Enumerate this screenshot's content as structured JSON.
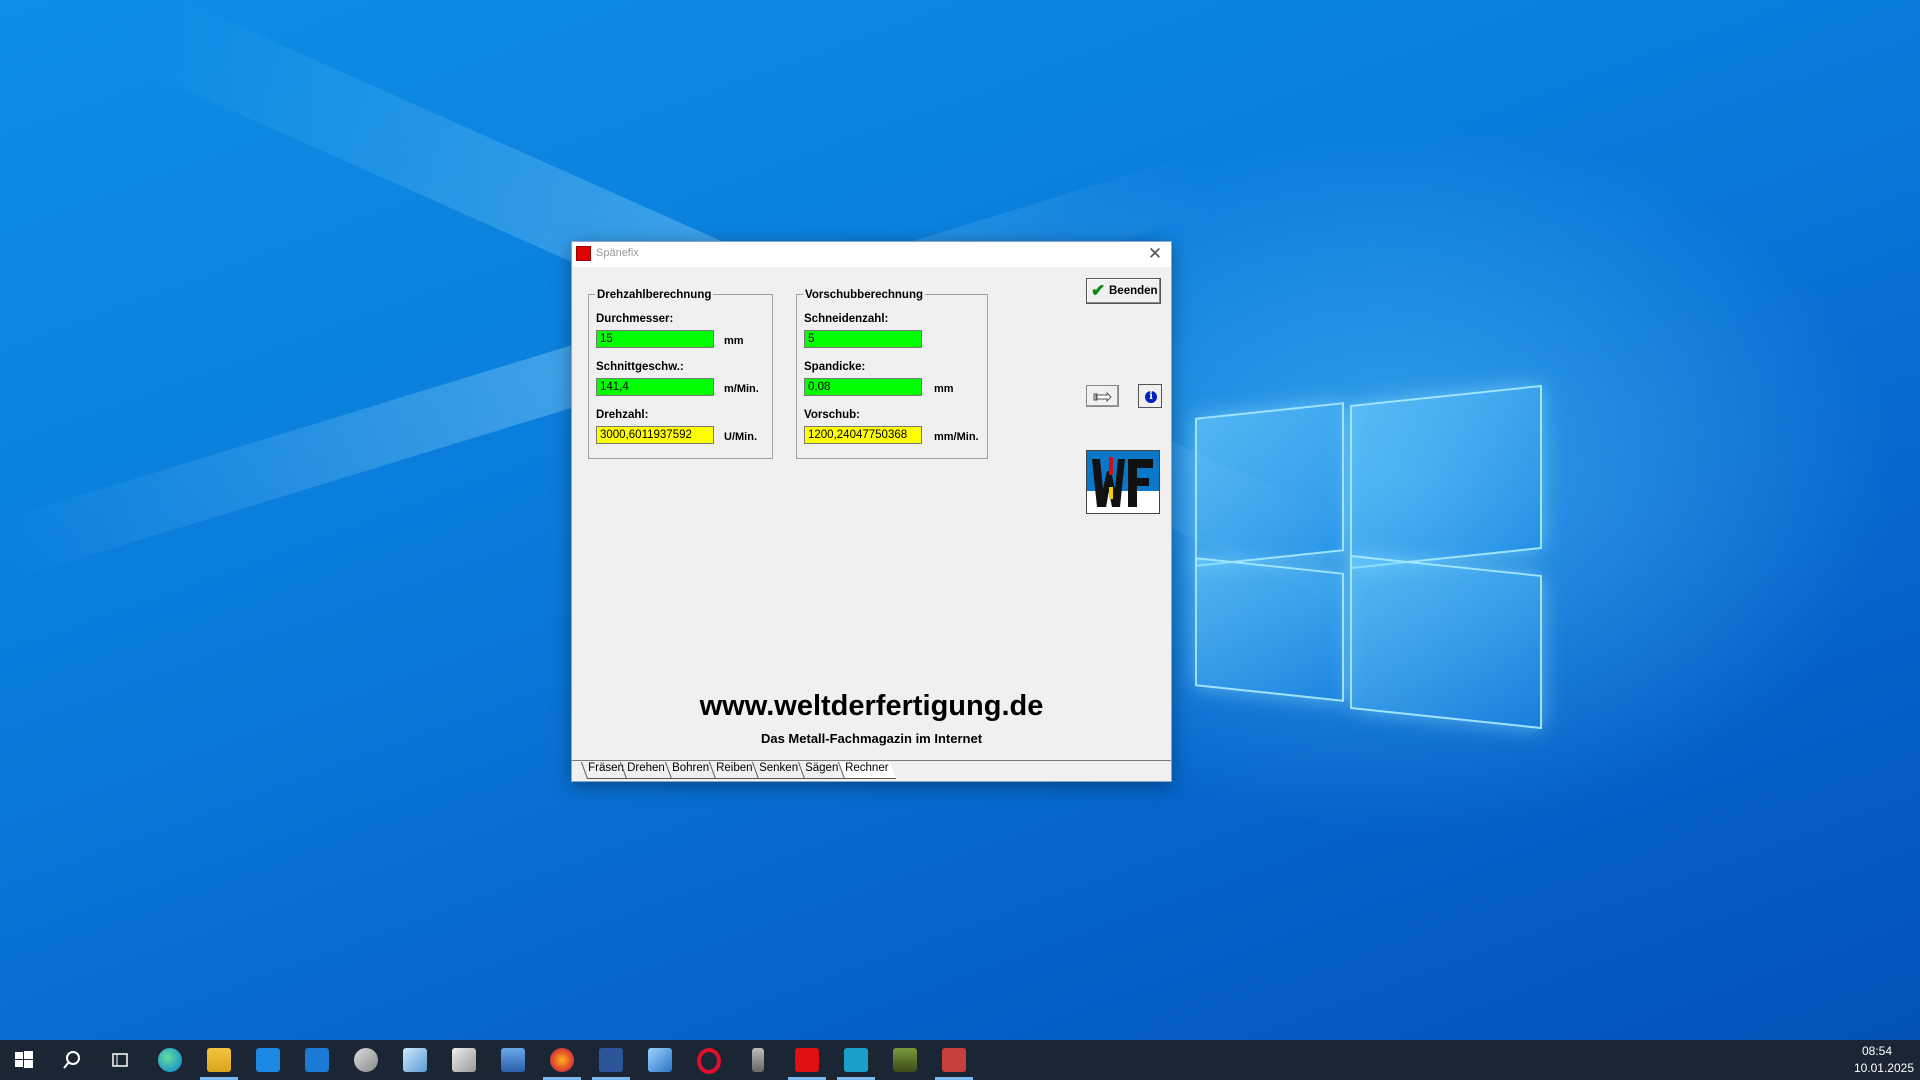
{
  "window": {
    "title": "Spänefix",
    "close_glyph": "✕",
    "beenden_label": "Beenden",
    "info_glyph": "i"
  },
  "drehzahl": {
    "group_title": "Drehzahlberechnung",
    "durchmesser_label": "Durchmesser:",
    "durchmesser_value": "15",
    "durchmesser_unit": "mm",
    "schnitt_label": "Schnittgeschw.:",
    "schnitt_value": "141,4",
    "schnitt_unit": "m/Min.",
    "drehzahl_label": "Drehzahl:",
    "drehzahl_value": "3000,6011937592",
    "drehzahl_unit": "U/Min."
  },
  "vorschub": {
    "group_title": "Vorschubberechnung",
    "schneiden_label": "Schneidenzahl:",
    "schneiden_value": "5",
    "spandicke_label": "Spandicke:",
    "spandicke_value": "0,08",
    "spandicke_unit": "mm",
    "vorschub_label": "Vorschub:",
    "vorschub_value": "1200,24047750368",
    "vorschub_unit": "mm/Min."
  },
  "footer": {
    "url": "www.weltderfertigung.de",
    "tagline": "Das Metall-Fachmagazin im Internet"
  },
  "tabs": [
    "Fräsen",
    "Drehen",
    "Bohren",
    "Reiben",
    "Senken",
    "Sägen",
    "Rechner"
  ],
  "active_tab": "Rechner",
  "taskbar": {
    "time": "08:54",
    "date": "10.01.2025",
    "icons": [
      "start-icon",
      "search-icon",
      "task-view-icon",
      "edge-icon",
      "file-explorer-icon",
      "store-icon",
      "mail-icon",
      "app-icon-1",
      "app-icon-2",
      "app-icon-3",
      "calculator-icon",
      "firefox-icon",
      "word-icon",
      "app-icon-4",
      "opera-icon",
      "app-icon-5",
      "app-icon-6",
      "camera-icon",
      "photo-icon",
      "app-icon-s"
    ]
  },
  "colors": {
    "input_green": "#00ff00",
    "output_yellow": "#ffff00",
    "desktop_blue": "#0a79d9",
    "taskbar": "#1a2634"
  }
}
